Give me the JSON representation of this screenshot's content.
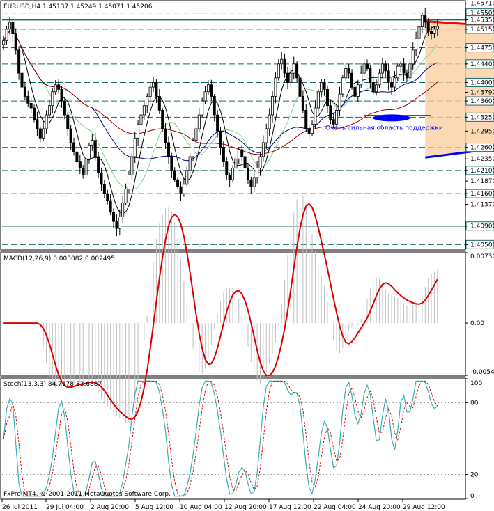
{
  "chart_data": [
    {
      "type": "candlestick",
      "title": "EURUSD,H4  1.45137 1.45249 1.45071 1.45206",
      "ylim": [
        1.404,
        1.4575
      ],
      "price_ticks": [
        "1.45710",
        "1.45500",
        "1.45350",
        "1.45150",
        "1.44750",
        "1.44400",
        "1.44000",
        "1.43790",
        "1.43600",
        "1.43250",
        "1.42950",
        "1.42600",
        "1.42350",
        "1.42100",
        "1.41870",
        "1.41600",
        "1.41370",
        "1.40900",
        "1.40500"
      ],
      "grid_levels": [
        1.455,
        1.4535,
        1.4515,
        1.4475,
        1.444,
        1.44,
        1.436,
        1.4325,
        1.426,
        1.421,
        1.416,
        1.409,
        1.405
      ],
      "highlight_labels": [
        "1.45500",
        "1.45350",
        "1.45150",
        "1.44750",
        "1.44400",
        "1.44000",
        "1.43600",
        "1.43250",
        "1.42600",
        "1.42100",
        "1.41600",
        "1.40900",
        "1.40500"
      ],
      "support_h_line": 1.409,
      "closes": [
        1.449,
        1.4515,
        1.453,
        1.4505,
        1.447,
        1.442,
        1.439,
        1.437,
        1.4355,
        1.4345,
        1.432,
        1.43,
        1.428,
        1.43,
        1.433,
        1.435,
        1.438,
        1.4395,
        1.4385,
        1.436,
        1.433,
        1.43,
        1.427,
        1.425,
        1.423,
        1.4215,
        1.42,
        1.4235,
        1.4265,
        1.4275,
        1.424,
        1.4205,
        1.418,
        1.416,
        1.4145,
        1.412,
        1.41,
        1.4085,
        1.411,
        1.414,
        1.417,
        1.42,
        1.424,
        1.428,
        1.431,
        1.433,
        1.435,
        1.437,
        1.439,
        1.44,
        1.437,
        1.434,
        1.43,
        1.427,
        1.424,
        1.421,
        1.419,
        1.4175,
        1.416,
        1.418,
        1.421,
        1.424,
        1.4275,
        1.43,
        1.433,
        1.436,
        1.438,
        1.4395,
        1.437,
        1.433,
        1.4295,
        1.426,
        1.423,
        1.42,
        1.419,
        1.4215,
        1.4235,
        1.4255,
        1.424,
        1.4215,
        1.419,
        1.4175,
        1.4195,
        1.4215,
        1.424,
        1.427,
        1.43,
        1.433,
        1.437,
        1.441,
        1.444,
        1.445,
        1.442,
        1.44,
        1.442,
        1.444,
        1.441,
        1.437,
        1.434,
        1.43,
        1.429,
        1.431,
        1.4345,
        1.438,
        1.44,
        1.4385,
        1.435,
        1.432,
        1.431,
        1.434,
        1.4375,
        1.441,
        1.443,
        1.442,
        1.439,
        1.437,
        1.4395,
        1.442,
        1.444,
        1.443,
        1.44,
        1.438,
        1.4395,
        1.442,
        1.444,
        1.4425,
        1.44,
        1.439,
        1.441,
        1.4435,
        1.444,
        1.442,
        1.441,
        1.444,
        1.447,
        1.4495,
        1.452,
        1.4545,
        1.453,
        1.451,
        1.4505,
        1.4515,
        1.4521
      ],
      "ma_period": [
        10,
        40,
        80
      ],
      "ma_colors": [
        "#000000",
        "#7ED38A",
        "#00007F",
        "#A00000"
      ],
      "triangle": {
        "top": [
          138,
          1.4532,
          370,
          1.4433
        ],
        "bottom": [
          138,
          1.4238,
          370,
          1.4433
        ],
        "fill": "#F9CC9C",
        "top_color": "#FF0000",
        "bottom_color": "#0000FF"
      },
      "annotation": "Очень сильная область поддержки",
      "annotation_color": "#0000FF",
      "ellipse_level": 1.4325,
      "x_ticks": [
        "26 Jul 2011",
        "29 Jul 04:00",
        "2 Aug 20:00",
        "5 Aug 12:00",
        "10 Aug 04:00",
        "12 Aug 20:00",
        "17 Aug 12:00",
        "22 Aug 04:00",
        "24 Aug 20:00",
        "29 Aug 12:00"
      ],
      "bull_color": "#000000",
      "bear_color": "#000000"
    },
    {
      "type": "line",
      "title": "MACD(12,26,9) 0.003082 0.002495",
      "ylim": [
        -0.00541,
        0.0073
      ],
      "y_ticks": [
        "0.00730",
        "0.00",
        "-0.00541"
      ],
      "signal_color": "#DD0000",
      "histogram_color": "#C0C0C0"
    },
    {
      "type": "line",
      "title": "Stoch(13,3,3) 84.7178 83.6887",
      "ylim": [
        0,
        100
      ],
      "y_ticks": [
        "100",
        "80",
        "20",
        "0"
      ],
      "main_color": "#3AAFAF",
      "signal_color": "#DD0000"
    }
  ],
  "footer": "FxPro MT4, © 2001-2011 MetaQuotes Software Corp."
}
